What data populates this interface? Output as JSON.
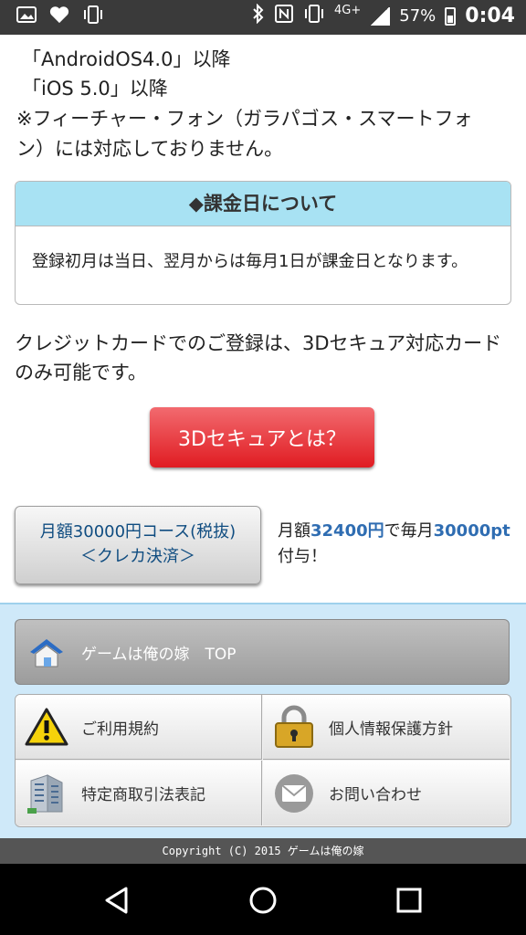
{
  "status_bar": {
    "network": "4G+",
    "battery": "57%",
    "time": "0:04",
    "icons_left": [
      "image-icon",
      "heart-icon",
      "vibrate-icon"
    ],
    "icons_right": [
      "bluetooth-icon",
      "nfc-icon",
      "vibrate-icon",
      "signal-icon",
      "battery-icon"
    ]
  },
  "requirements": {
    "android": "「AndroidOS4.0」以降",
    "ios": "「iOS 5.0」以降",
    "notice": "※フィーチャー・フォン（ガラパゴス・スマートフォン）には対応しておりません。"
  },
  "billing": {
    "title": "◆課金日について",
    "body": "登録初月は当日、翌月からは毎月1日が課金日となります。"
  },
  "card_notice": "クレジットカードでのご登録は、3Dセキュア対応カードのみ可能です。",
  "secure_button": "3Dセキュアとは？",
  "course": {
    "line1": "月額30000円コース(税抜)",
    "line2": "＜クレカ決済＞",
    "desc_a": "月額",
    "price": "32400円",
    "desc_b": "で毎月",
    "points": "30000pt",
    "desc_c": "付与！"
  },
  "footer_nav": {
    "top": "ゲームは俺の嫁　TOP",
    "terms": "ご利用規約",
    "privacy": "個人情報保護方針",
    "commerce": "特定商取引法表記",
    "contact": "お問い合わせ"
  },
  "copyright": "Copyright (C) 2015 ゲームは俺の嫁",
  "colors": {
    "accent_red": "#e01c22",
    "billing_header": "#a8e2f3",
    "highlight_blue": "#2f6db2",
    "footer_bg": "#cfe9f9"
  }
}
